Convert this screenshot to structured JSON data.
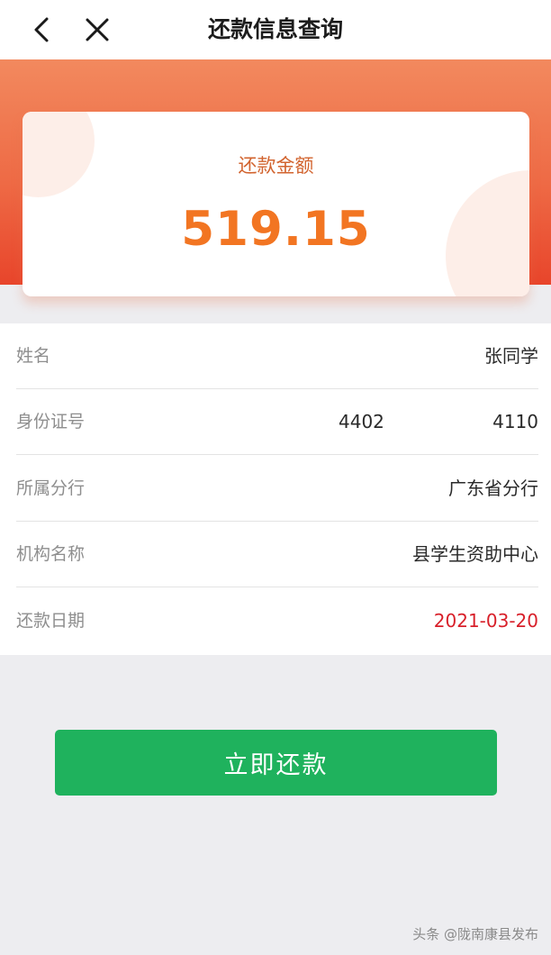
{
  "header": {
    "title": "还款信息查询",
    "back_icon": "chevron-left-icon",
    "close_icon": "close-icon"
  },
  "amount_card": {
    "label": "还款金额",
    "value": "519.15"
  },
  "info": {
    "name_label": "姓名",
    "name_value": "张同学",
    "id_label": "身份证号",
    "id_value_part1": "4402",
    "id_value_part2": "4110",
    "branch_label": "所属分行",
    "branch_value": "广东省分行",
    "org_label": "机构名称",
    "org_value": "县学生资助中心",
    "date_label": "还款日期",
    "date_value": "2021-03-20"
  },
  "actions": {
    "pay_label": "立即还款"
  },
  "watermark": {
    "text": "头条 @陇南康县发布"
  },
  "colors": {
    "accent_orange": "#f27522",
    "banner_red": "#e8452b",
    "button_green": "#1fb25d",
    "date_red": "#d8202a"
  }
}
